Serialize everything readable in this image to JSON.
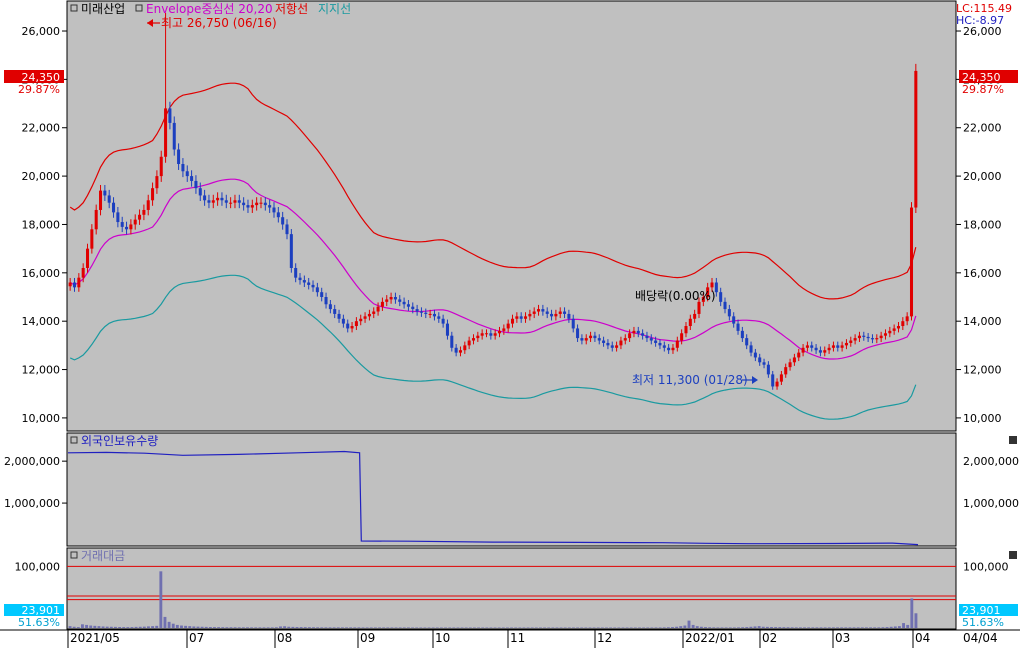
{
  "colors": {
    "plot_bg": "#c0c0c0",
    "frame": "#000000",
    "up": "#e00000",
    "down": "#1c3fbf",
    "envelope_upper": "#e00000",
    "envelope_center": "#cc00cc",
    "support_line": "#1a9aa0",
    "foreign_line": "#2020c0",
    "volume_bar": "#7070b0",
    "ref_line": "#e00000",
    "badge_red": "#e00000",
    "badge_cyan": "#00c8ff"
  },
  "legend": {
    "stock": "미래산업",
    "envelope": "Envelope중심선 20,20",
    "resistance": "저항선",
    "support": "지지선"
  },
  "readout": {
    "lc": "LC:115.49",
    "hc": "HC:-8.97"
  },
  "price_badge": {
    "value": "24,350",
    "pct": "29.87%"
  },
  "volume_badge": {
    "value": "23,901",
    "pct": "51.63%"
  },
  "annotations": {
    "high": "최고 26,750 (06/16)",
    "low": "최저 11,300 (01/28)",
    "dividend": "배당락(0.00%)"
  },
  "foreign_panel": {
    "title": "외국인보유수량"
  },
  "volume_panel": {
    "title": "거래대금"
  },
  "chart_data": [
    {
      "type": "candlestick",
      "title": "미래산업",
      "yticks": [
        "26,000",
        "24,000",
        "22,000",
        "20,000",
        "18,000",
        "16,000",
        "14,000",
        "12,000",
        "10,000"
      ],
      "ylim": [
        9500,
        27200
      ],
      "xticks": [
        "2021/05",
        "07",
        "08",
        "09",
        "10",
        "11",
        "12",
        "2022/01",
        "02",
        "03",
        "04"
      ],
      "high": {
        "value": 26750,
        "date": "06/16"
      },
      "low": {
        "value": 11300,
        "date": "01/28"
      },
      "last_close": 24350,
      "change_pct": 29.87,
      "closes": [
        15600,
        15400,
        15800,
        16200,
        17000,
        17800,
        18600,
        19400,
        19200,
        18900,
        18500,
        18100,
        17900,
        17800,
        18000,
        18200,
        18400,
        18600,
        19000,
        19500,
        20000,
        20800,
        22800,
        22200,
        21100,
        20500,
        20200,
        20000,
        19800,
        19500,
        19200,
        19000,
        18900,
        19000,
        19100,
        19000,
        18900,
        18900,
        19000,
        18900,
        18800,
        18700,
        18800,
        18900,
        18900,
        18800,
        18700,
        18500,
        18300,
        18000,
        17600,
        16200,
        15800,
        15700,
        15600,
        15500,
        15400,
        15200,
        15000,
        14700,
        14500,
        14300,
        14100,
        13900,
        13700,
        13800,
        14000,
        14100,
        14200,
        14300,
        14400,
        14600,
        14800,
        14900,
        15000,
        14900,
        14800,
        14700,
        14600,
        14500,
        14400,
        14350,
        14300,
        14300,
        14200,
        14100,
        13900,
        13400,
        12900,
        12700,
        12800,
        13000,
        13200,
        13300,
        13400,
        13500,
        13500,
        13400,
        13500,
        13600,
        13700,
        13900,
        14100,
        14200,
        14100,
        14200,
        14300,
        14400,
        14500,
        14400,
        14300,
        14200,
        14300,
        14400,
        14300,
        14100,
        13700,
        13300,
        13200,
        13300,
        13400,
        13300,
        13200,
        13100,
        13000,
        12900,
        13000,
        13200,
        13300,
        13500,
        13600,
        13500,
        13400,
        13300,
        13200,
        13100,
        13000,
        12900,
        12800,
        12900,
        13200,
        13500,
        13800,
        14100,
        14300,
        14800,
        15000,
        15400,
        15600,
        15200,
        14800,
        14500,
        14200,
        13900,
        13600,
        13300,
        13000,
        12700,
        12500,
        12300,
        12200,
        11800,
        11300,
        11500,
        11800,
        12100,
        12300,
        12500,
        12700,
        12900,
        13000,
        12900,
        12800,
        12700,
        12800,
        12900,
        13000,
        12900,
        13000,
        13100,
        13200,
        13300,
        13400,
        13350,
        13300,
        13250,
        13300,
        13400,
        13500,
        13600,
        13700,
        13800,
        14000,
        14200,
        18700,
        24350
      ]
    },
    {
      "type": "line",
      "title": "외국인보유수량",
      "yticks": [
        "2,000,000",
        "1,000,000"
      ],
      "ylim": [
        0,
        2600000
      ],
      "x_fraction": [
        0.0,
        0.045,
        0.09,
        0.135,
        0.2,
        0.27,
        0.325,
        0.343,
        0.345,
        0.4,
        0.5,
        0.6,
        0.7,
        0.75,
        0.8,
        0.9,
        0.97,
        1.0
      ],
      "values": [
        2200000,
        2210000,
        2190000,
        2140000,
        2160000,
        2200000,
        2230000,
        2200000,
        95000,
        90000,
        70000,
        62000,
        55000,
        40000,
        30000,
        35000,
        45000,
        10000
      ]
    },
    {
      "type": "bar",
      "title": "거래대금",
      "yticks": [
        "100,000"
      ],
      "ylim": [
        0,
        125000
      ],
      "reference_lines": [
        100000,
        52000,
        46000
      ],
      "last_value": 23901,
      "last_pct": 51.63,
      "bars": [
        3000,
        2000,
        1500,
        6000,
        5000,
        4000,
        3500,
        3000,
        2500,
        2200,
        2000,
        1800,
        1600,
        1500,
        1400,
        1500,
        1800,
        2000,
        2200,
        2600,
        3000,
        3500,
        92000,
        18000,
        10000,
        7000,
        5000,
        4000,
        3500,
        3000,
        2500,
        2200,
        2000,
        1800,
        1600,
        1500,
        1400,
        1300,
        1200,
        1200,
        1200,
        1100,
        1100,
        1100,
        1000,
        1000,
        1000,
        1000,
        1000,
        1000,
        1200,
        2500,
        2800,
        2000,
        1800,
        1600,
        1500,
        1400,
        1300,
        1200,
        1100,
        1000,
        1000,
        1000,
        1000,
        1000,
        1000,
        1000,
        1000,
        1000,
        1000,
        900,
        900,
        900,
        900,
        900,
        900,
        900,
        900,
        900,
        900,
        900,
        900,
        800,
        800,
        800,
        800,
        800,
        800,
        800,
        800,
        800,
        800,
        800,
        800,
        800,
        800,
        800,
        800,
        800,
        800,
        800,
        800,
        800,
        800,
        800,
        800,
        800,
        800,
        800,
        800,
        800,
        800,
        800,
        800,
        800,
        800,
        800,
        800,
        800,
        800,
        800,
        800,
        800,
        800,
        800,
        800,
        800,
        800,
        800,
        800,
        800,
        800,
        800,
        800,
        800,
        800,
        800,
        800,
        800,
        800,
        800,
        900,
        900,
        1000,
        1200,
        1500,
        2000,
        3000,
        4000,
        12000,
        5000,
        3000,
        2000,
        1500,
        1200,
        1000,
        900,
        900,
        900,
        900,
        900,
        1000,
        1200,
        1500,
        2000,
        2500,
        3000,
        2000,
        1800,
        1600,
        1500,
        1400,
        1300,
        1200,
        1100,
        1000,
        1000,
        1000,
        1000,
        1000,
        1000,
        1000,
        1000,
        1000,
        1000,
        1000,
        1000,
        1000,
        1000,
        1000,
        1000,
        1000,
        1000,
        1000,
        1000,
        1000,
        1200,
        1500,
        2000,
        2500,
        3000,
        8000,
        5000,
        48000,
        23901
      ]
    }
  ]
}
